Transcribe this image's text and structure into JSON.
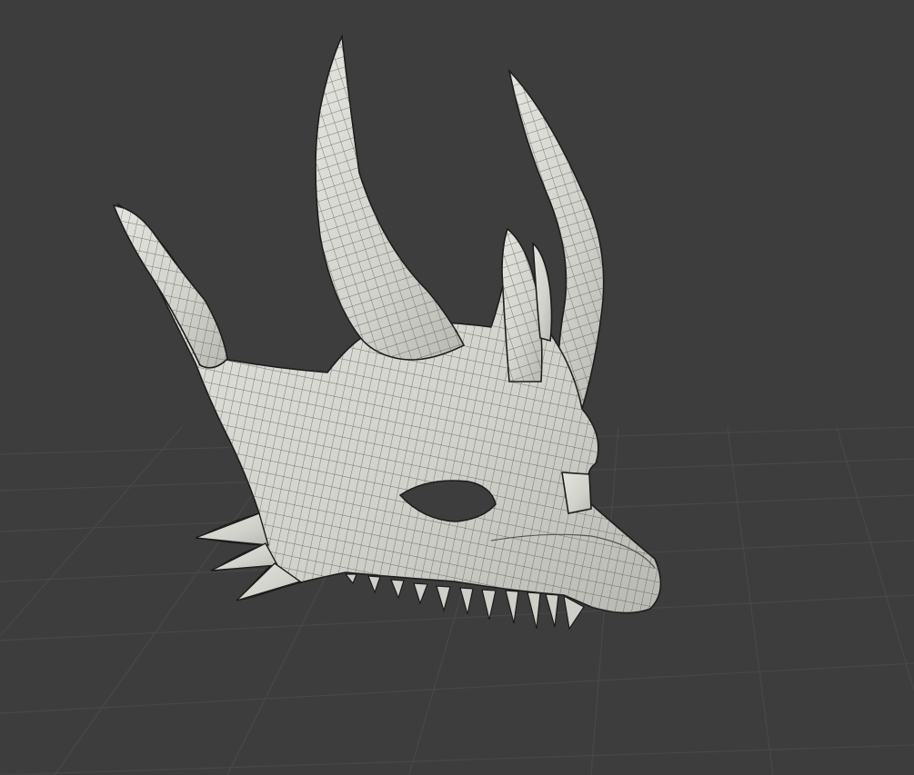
{
  "viewport": {
    "kind": "3d-viewport",
    "shading": "solid-with-wireframe",
    "background_color": "#3d3d3d",
    "grid_color": "#4a4a4a",
    "mesh_color": "#d9d9d4",
    "wire_color": "#3a3a3a",
    "show_floor_grid": true
  },
  "object": {
    "label": "dragon-skull-mask",
    "parts": [
      "horn-left-outer",
      "horn-left-inner",
      "horn-right-back",
      "horn-center-small",
      "horn-center-tiny",
      "cheek-spikes",
      "eye-socket",
      "snout",
      "upper-teeth"
    ]
  }
}
